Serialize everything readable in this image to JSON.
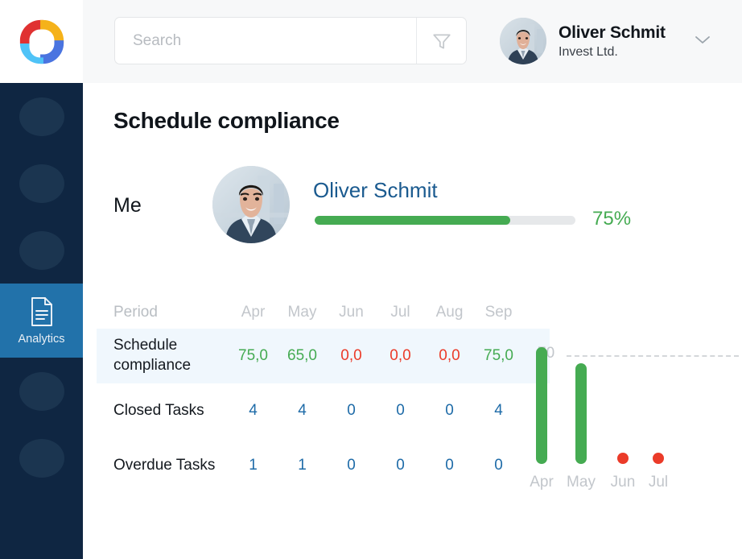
{
  "brand": {
    "logo_name": "pinwheel-logo",
    "colors": {
      "red": "#e03131",
      "yellow": "#f5b21a",
      "blue": "#4a74e0",
      "cyan": "#4fc3f7"
    }
  },
  "header": {
    "search": {
      "placeholder": "Search",
      "value": ""
    },
    "filter_icon": "filter-funnel-icon",
    "user": {
      "name": "Oliver Schmit",
      "org": "Invest Ltd.",
      "avatar": "user-avatar-photo",
      "chevron": "chevron-down-icon"
    }
  },
  "sidebar": {
    "items": [
      {
        "label": "",
        "icon": "placeholder-icon",
        "active": false
      },
      {
        "label": "",
        "icon": "placeholder-icon",
        "active": false
      },
      {
        "label": "",
        "icon": "placeholder-icon",
        "active": false
      },
      {
        "label": "Analytics",
        "icon": "document-report-icon",
        "active": true
      },
      {
        "label": "",
        "icon": "placeholder-icon",
        "active": false
      },
      {
        "label": "",
        "icon": "placeholder-icon",
        "active": false
      }
    ],
    "active_label": "Analytics",
    "active_color": "#2272aa",
    "background": "#0f2642"
  },
  "main": {
    "title": "Schedule compliance",
    "me_label": "Me",
    "person": {
      "name": "Oliver Schmit",
      "avatar": "person-avatar-photo"
    },
    "progress": {
      "percent_label": "75%",
      "percent": 75,
      "color": "#45ab52",
      "track_color": "#e6e8ea"
    }
  },
  "table": {
    "columns": [
      "Period",
      "Apr",
      "May",
      "Jun",
      "Jul",
      "Aug",
      "Sep"
    ],
    "rows": [
      {
        "label": "Schedule compliance",
        "highlight": true,
        "values": [
          "75,0",
          "65,0",
          "0,0",
          "0,0",
          "0,0",
          "75,0"
        ],
        "value_colors": [
          "green",
          "green",
          "red",
          "red",
          "red",
          "green"
        ]
      },
      {
        "label": "Closed Tasks",
        "highlight": false,
        "values": [
          "4",
          "4",
          "0",
          "0",
          "0",
          "4"
        ],
        "value_colors": [
          "blue",
          "blue",
          "blue",
          "blue",
          "blue",
          "blue"
        ]
      },
      {
        "label": "Overdue Tasks",
        "highlight": false,
        "values": [
          "1",
          "1",
          "0",
          "0",
          "0",
          "0"
        ],
        "value_colors": [
          "blue",
          "blue",
          "blue",
          "blue",
          "blue",
          "blue"
        ]
      }
    ]
  },
  "chart_data": {
    "type": "bar",
    "title": "",
    "xlabel": "",
    "ylabel": "",
    "categories": [
      "Apr",
      "May",
      "Jun",
      "Jul"
    ],
    "values": [
      75,
      65,
      0,
      0
    ],
    "series": [
      {
        "name": "Schedule compliance",
        "values": [
          75,
          65,
          0,
          0
        ]
      }
    ],
    "reference_line": {
      "value": 70,
      "label": "70",
      "style": "dashed",
      "color": "#d4d7da"
    },
    "bar_colors": [
      "#45ab52",
      "#45ab52",
      "#eb3b29",
      "#eb3b29"
    ],
    "zero_marker": "dot",
    "ylim": [
      0,
      86
    ],
    "grid": false,
    "legend": "none"
  }
}
